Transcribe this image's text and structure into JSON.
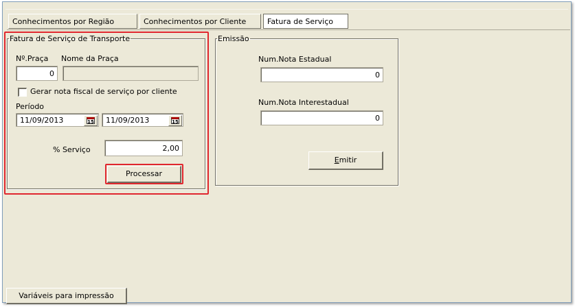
{
  "tabs": [
    {
      "label": "Conhecimentos por Região",
      "active": false
    },
    {
      "label": "Conhecimentos por Cliente",
      "active": false
    },
    {
      "label": "Fatura de Serviço",
      "active": true
    }
  ],
  "fatura_group": {
    "legend": "Fatura de Serviço de Transporte",
    "num_praca_label": "Nº.Praça",
    "nome_praca_label": "Nome da Praça",
    "num_praca_value": "0",
    "nome_praca_value": "",
    "checkbox_label": "Gerar nota fiscal de serviço por cliente",
    "checkbox_checked": false,
    "periodo_label": "Período",
    "date_from": "11/09/2013",
    "date_to": "11/09/2013",
    "servico_label": "% Serviço",
    "servico_value": "2,00",
    "processar_label": "Processar"
  },
  "emissao_group": {
    "legend": "Emissão",
    "nota_estadual_label": "Num.Nota Estadual",
    "nota_estadual_value": "0",
    "nota_interestadual_label": "Num.Nota Interestadual",
    "nota_interestadual_value": "0",
    "emitir_prefix": "E",
    "emitir_rest": "mitir"
  },
  "bottom": {
    "variaveis_label": "Variáveis para impressão"
  },
  "colors": {
    "highlight": "#e0262e",
    "window_bg": "#ece9d8"
  },
  "icons": {
    "calendar": "calendar-icon"
  }
}
